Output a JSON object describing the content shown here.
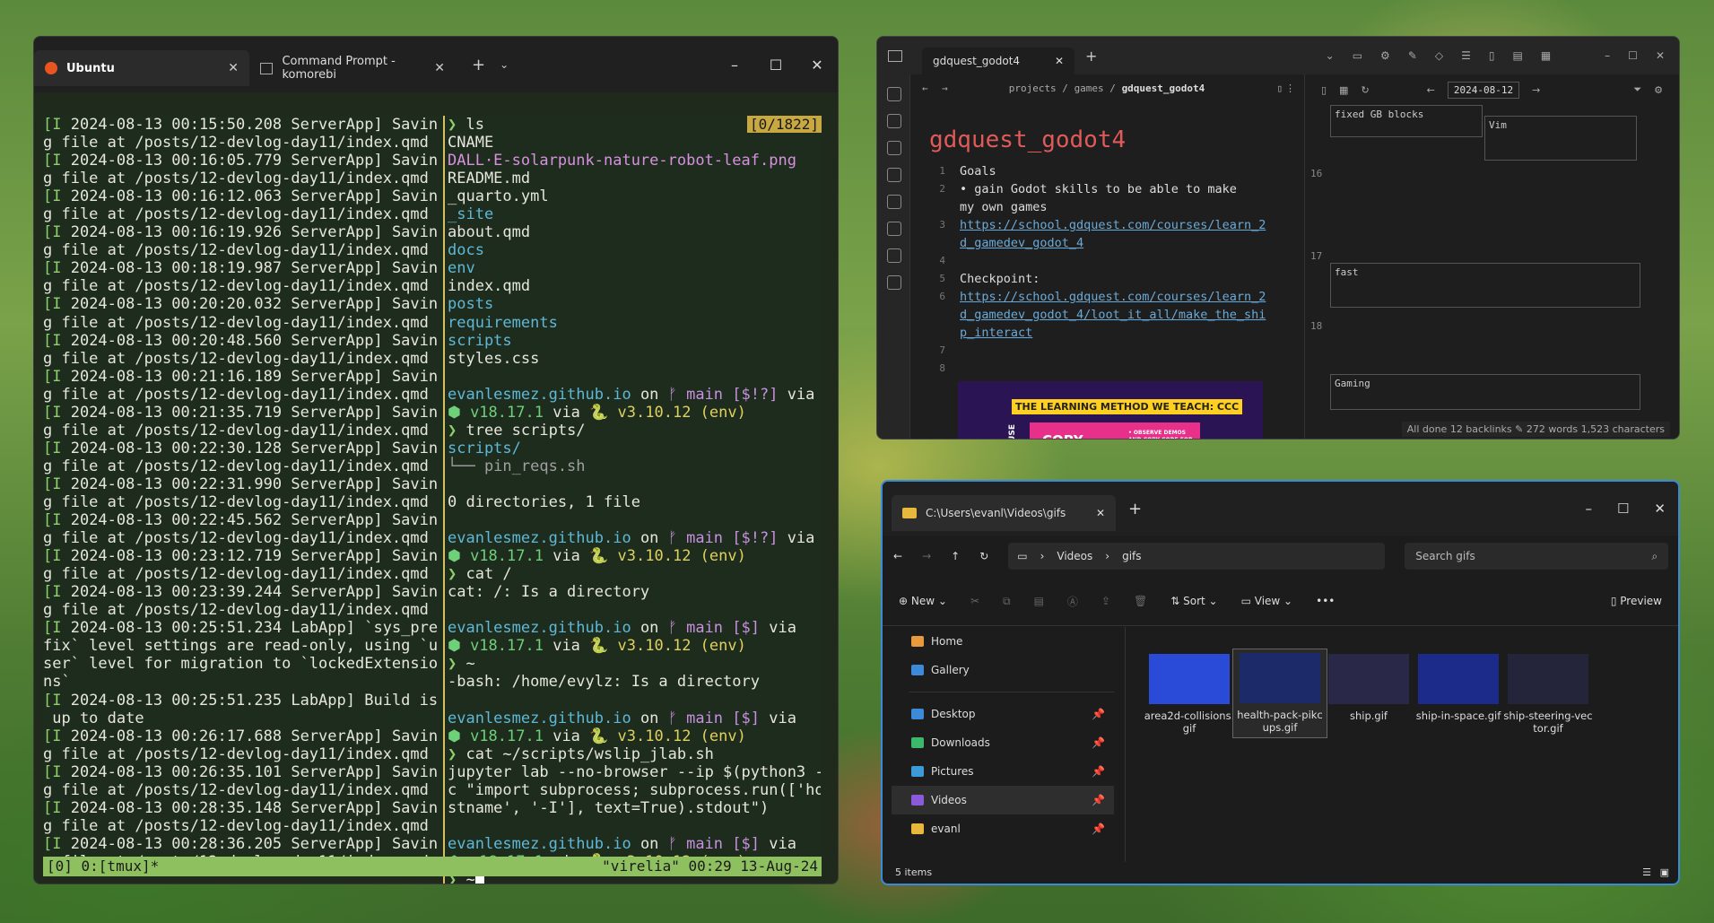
{
  "terminal": {
    "tabs": [
      {
        "label": "Ubuntu",
        "icon": "ubuntu-icon"
      },
      {
        "label": "Command Prompt - komorebi",
        "icon": "cmd-icon"
      }
    ],
    "counter": "[0/1822]",
    "left_lines": [
      "[I 2024-08-13 00:15:50.208 ServerApp] Savin",
      "g file at /posts/12-devlog-day11/index.qmd",
      "[I 2024-08-13 00:16:05.779 ServerApp] Savin",
      "g file at /posts/12-devlog-day11/index.qmd",
      "[I 2024-08-13 00:16:12.063 ServerApp] Savin",
      "g file at /posts/12-devlog-day11/index.qmd",
      "[I 2024-08-13 00:16:19.926 ServerApp] Savin",
      "g file at /posts/12-devlog-day11/index.qmd",
      "[I 2024-08-13 00:18:19.987 ServerApp] Savin",
      "g file at /posts/12-devlog-day11/index.qmd",
      "[I 2024-08-13 00:20:20.032 ServerApp] Savin",
      "g file at /posts/12-devlog-day11/index.qmd",
      "[I 2024-08-13 00:20:48.560 ServerApp] Savin",
      "g file at /posts/12-devlog-day11/index.qmd",
      "[I 2024-08-13 00:21:16.189 ServerApp] Savin",
      "g file at /posts/12-devlog-day11/index.qmd",
      "[I 2024-08-13 00:21:35.719 ServerApp] Savin",
      "g file at /posts/12-devlog-day11/index.qmd",
      "[I 2024-08-13 00:22:30.128 ServerApp] Savin",
      "g file at /posts/12-devlog-day11/index.qmd",
      "[I 2024-08-13 00:22:31.990 ServerApp] Savin",
      "g file at /posts/12-devlog-day11/index.qmd",
      "[I 2024-08-13 00:22:45.562 ServerApp] Savin",
      "g file at /posts/12-devlog-day11/index.qmd",
      "[I 2024-08-13 00:23:12.719 ServerApp] Savin",
      "g file at /posts/12-devlog-day11/index.qmd",
      "[I 2024-08-13 00:23:39.244 ServerApp] Savin",
      "g file at /posts/12-devlog-day11/index.qmd",
      "[I 2024-08-13 00:25:51.234 LabApp] `sys_pre",
      "fix` level settings are read-only, using `u",
      "ser` level for migration to `lockedExtensio",
      "ns`",
      "[I 2024-08-13 00:25:51.235 LabApp] Build is",
      " up to date",
      "[I 2024-08-13 00:26:17.688 ServerApp] Savin",
      "g file at /posts/12-devlog-day11/index.qmd",
      "[I 2024-08-13 00:26:35.101 ServerApp] Savin",
      "g file at /posts/12-devlog-day11/index.qmd",
      "[I 2024-08-13 00:28:35.148 ServerApp] Savin",
      "g file at /posts/12-devlog-day11/index.qmd",
      "[I 2024-08-13 00:28:36.205 ServerApp] Savin",
      "g file at /posts/12-devlog-day11/index.qmd"
    ],
    "right": {
      "cmd_ls": "ls",
      "ls_output": [
        {
          "t": "CNAME",
          "k": ""
        },
        {
          "t": "DALL·E-solarpunk-nature-robot-leaf.png",
          "k": "img"
        },
        {
          "t": "README.md",
          "k": ""
        },
        {
          "t": "_quarto.yml",
          "k": ""
        },
        {
          "t": "_site",
          "k": "dir"
        },
        {
          "t": "about.qmd",
          "k": ""
        },
        {
          "t": "docs",
          "k": "dir"
        },
        {
          "t": "env",
          "k": "dir"
        },
        {
          "t": "index.qmd",
          "k": ""
        },
        {
          "t": "posts",
          "k": "dir"
        },
        {
          "t": "requirements",
          "k": "dir"
        },
        {
          "t": "scripts",
          "k": "dir"
        },
        {
          "t": "styles.css",
          "k": ""
        }
      ],
      "repo": "evanlesmez.github.io",
      "on": "on",
      "branch": "main",
      "status1": "[$!?]",
      "status2": "[$]",
      "via": "via",
      "node_ver": "v18.17.1",
      "py_ver": "v3.10.12",
      "env": "(env)",
      "cmd_tree": "tree scripts/",
      "tree_root": "scripts/",
      "tree_file": "└── pin_reqs.sh",
      "tree_summary": "0 directories, 1 file",
      "cmd_cat_root": "cat /",
      "cat_root_out": "cat: /: Is a directory",
      "cmd_tilde": "~",
      "tilde_out": "-bash: /home/evylz: Is a directory",
      "cmd_cat_script": "cat ~/scripts/wslip_jlab.sh",
      "script_out": [
        "jupyter lab --no-browser --ip $(python3 -",
        "c \"import subprocess; subprocess.run(['ho",
        "stname', '-I'], text=True).stdout\")"
      ],
      "cmd_final": "~"
    },
    "status_left": "[0] 0:[tmux]*",
    "status_right": "\"virelia\" 00:29 13-Aug-24"
  },
  "obsidian": {
    "tab_title": "gdquest_godot4",
    "breadcrumb": [
      "projects",
      "games",
      "gdquest_godot4"
    ],
    "note_title": "gdquest_godot4",
    "lines": [
      {
        "n": "1",
        "text": "Goals",
        "type": "text"
      },
      {
        "n": "2",
        "text": "gain Godot skills to be able to make",
        "type": "bullet"
      },
      {
        "n": "",
        "text": "my own games",
        "type": "cont"
      },
      {
        "n": "3",
        "text": "https://school.gdquest.com/courses/learn_2",
        "type": "link"
      },
      {
        "n": "",
        "text": "d_gamedev_godot_4",
        "type": "link"
      },
      {
        "n": "4",
        "text": "",
        "type": "text"
      },
      {
        "n": "5",
        "text": "Checkpoint:",
        "type": "text"
      },
      {
        "n": "6",
        "text": "https://school.gdquest.com/courses/learn_2",
        "type": "link"
      },
      {
        "n": "",
        "text": "d_gamedev_godot_4/loot_it_all/make_the_shi",
        "type": "link"
      },
      {
        "n": "",
        "text": "p_interact",
        "type": "link"
      },
      {
        "n": "7",
        "text": "",
        "type": "text"
      },
      {
        "n": "8",
        "text": "",
        "type": "text"
      }
    ],
    "banner_top": "THE LEARNING METHOD WE TEACH: CCC",
    "banner_copy": "COPY",
    "banner_side": "REUSE",
    "banner_note": "• OBSERVE DEMOS AND COPY CODE FOR SIMILAR RESULTS",
    "date": "2024-08-12",
    "kanban": {
      "card_top": "fixed GB blocks",
      "card_vim": "Vim",
      "row16": "16",
      "row17": "17",
      "card_fast": "fast",
      "row18": "18",
      "card_gaming": "Gaming"
    },
    "footer": "All done  12 backlinks  ✎  272 words 1,523 characters"
  },
  "explorer": {
    "tab_title": "C:\\Users\\evanl\\Videos\\gifs",
    "path": [
      "Videos",
      "gifs"
    ],
    "search_placeholder": "Search gifs",
    "cmd": {
      "new": "New",
      "sort": "Sort",
      "view": "View",
      "preview": "Preview"
    },
    "sidebar": [
      {
        "label": "Home",
        "icon": "home-icon",
        "pin": false,
        "color": "#e89a3c"
      },
      {
        "label": "Gallery",
        "icon": "gallery-icon",
        "pin": false,
        "color": "#3c8ad8"
      },
      {
        "label": "Desktop",
        "icon": "desktop-icon",
        "pin": true,
        "color": "#3c8ad8"
      },
      {
        "label": "Downloads",
        "icon": "downloads-icon",
        "pin": true,
        "color": "#3cb86a"
      },
      {
        "label": "Pictures",
        "icon": "pictures-icon",
        "pin": true,
        "color": "#3c9ad8"
      },
      {
        "label": "Videos",
        "icon": "videos-icon",
        "pin": true,
        "color": "#8a5ad8"
      },
      {
        "label": "evanl",
        "icon": "folder-icon",
        "pin": true,
        "color": "#e8b83c"
      }
    ],
    "files": [
      {
        "name": "area2d-collisions.\ngif",
        "thumb": "#2a4ad8"
      },
      {
        "name": "health-pack-pikc\nups.gif",
        "thumb": "#1c2a6a"
      },
      {
        "name": "ship.gif",
        "thumb": "#2a2848"
      },
      {
        "name": "ship-in-space.gif",
        "thumb": "#1c2a8a"
      },
      {
        "name": "ship-steering-vec\ntor.gif",
        "thumb": "#24243a"
      }
    ],
    "status": "5 items"
  }
}
